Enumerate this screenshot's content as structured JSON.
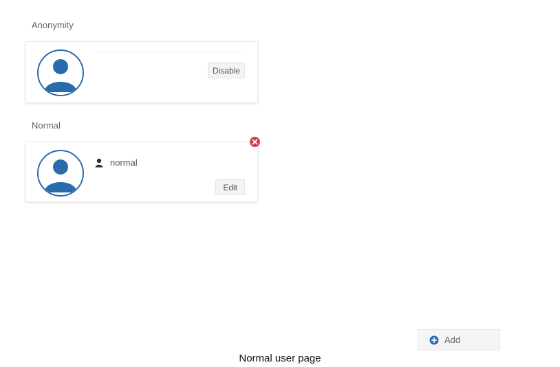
{
  "anonymity": {
    "title": "Anonymity",
    "disable_label": "Disable",
    "avatar_icon": "user-avatar-icon"
  },
  "normal": {
    "title": "Normal",
    "username": "normal",
    "edit_label": "Edit",
    "remove_icon": "close-circle-icon",
    "user_icon": "person-icon"
  },
  "add_button": {
    "label": "Add",
    "icon": "plus-circle-icon"
  },
  "caption": "Normal user page",
  "colors": {
    "avatar_blue": "#2a6bab",
    "remove_red": "#d9394e"
  }
}
